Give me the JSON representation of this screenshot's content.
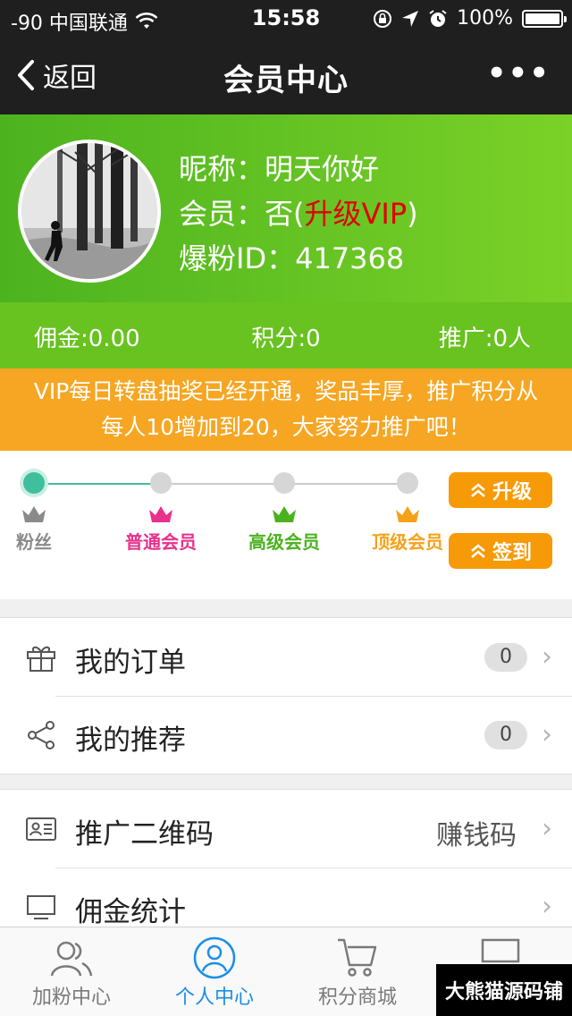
{
  "status_bar": {
    "carrier": "-90 中国联通",
    "time": "15:58",
    "battery": "100%",
    "icons": [
      "wifi-icon",
      "rotation-lock-icon",
      "location-icon",
      "alarm-icon",
      "battery-icon"
    ]
  },
  "nav": {
    "back_label": "返回",
    "title": "会员中心",
    "more_label": "•••"
  },
  "profile": {
    "nickname_label": "昵称：",
    "nickname": "明天你好",
    "member_label": "会员：",
    "member_value": "否(",
    "upgrade_link": "升级VIP",
    "member_close": ")",
    "id_label": "爆粉ID：",
    "id_value": "417368"
  },
  "stats": {
    "commission": "佣金:0.00",
    "points": "积分:0",
    "promotion": "推广:0人"
  },
  "notice": {
    "line1": "VIP每日转盘抽奖已经开通，奖品丰厚，推广积分从",
    "line2": "每人10增加到20，大家努力推广吧！"
  },
  "levels": {
    "items": [
      {
        "label": "粉丝",
        "color": "#8a8a8a"
      },
      {
        "label": "普通会员",
        "color": "#e8318b"
      },
      {
        "label": "高级会员",
        "color": "#4bb21f"
      },
      {
        "label": "顶级会员",
        "color": "#f5a21b"
      }
    ],
    "current_index": 0,
    "upgrade_button": "升级",
    "checkin_button": "签到"
  },
  "menu": {
    "group1": [
      {
        "label": "我的订单",
        "badge": "0",
        "icon": "gift-icon"
      },
      {
        "label": "我的推荐",
        "badge": "0",
        "icon": "share-icon"
      }
    ],
    "group2": [
      {
        "label": "推广二维码",
        "value": "赚钱码",
        "icon": "id-card-icon"
      },
      {
        "label": "佣金统计",
        "icon": "monitor-icon"
      }
    ],
    "arrow": "›"
  },
  "tabbar": {
    "tabs": [
      {
        "label": "加粉中心",
        "icon": "users-icon"
      },
      {
        "label": "个人中心",
        "icon": "person-icon"
      },
      {
        "label": "积分商城",
        "icon": "cart-icon"
      }
    ],
    "active_index": 1,
    "active_color": "#1a8ee8"
  },
  "watermark": "大熊猫源码铺",
  "colors": {
    "nav_bg": "#1f1f1f",
    "profile_green": "#6cc423",
    "notice_orange": "#f6a623",
    "button_orange": "#f79a07",
    "vip_red": "#e00000",
    "progress_teal": "#3fbf9b"
  }
}
